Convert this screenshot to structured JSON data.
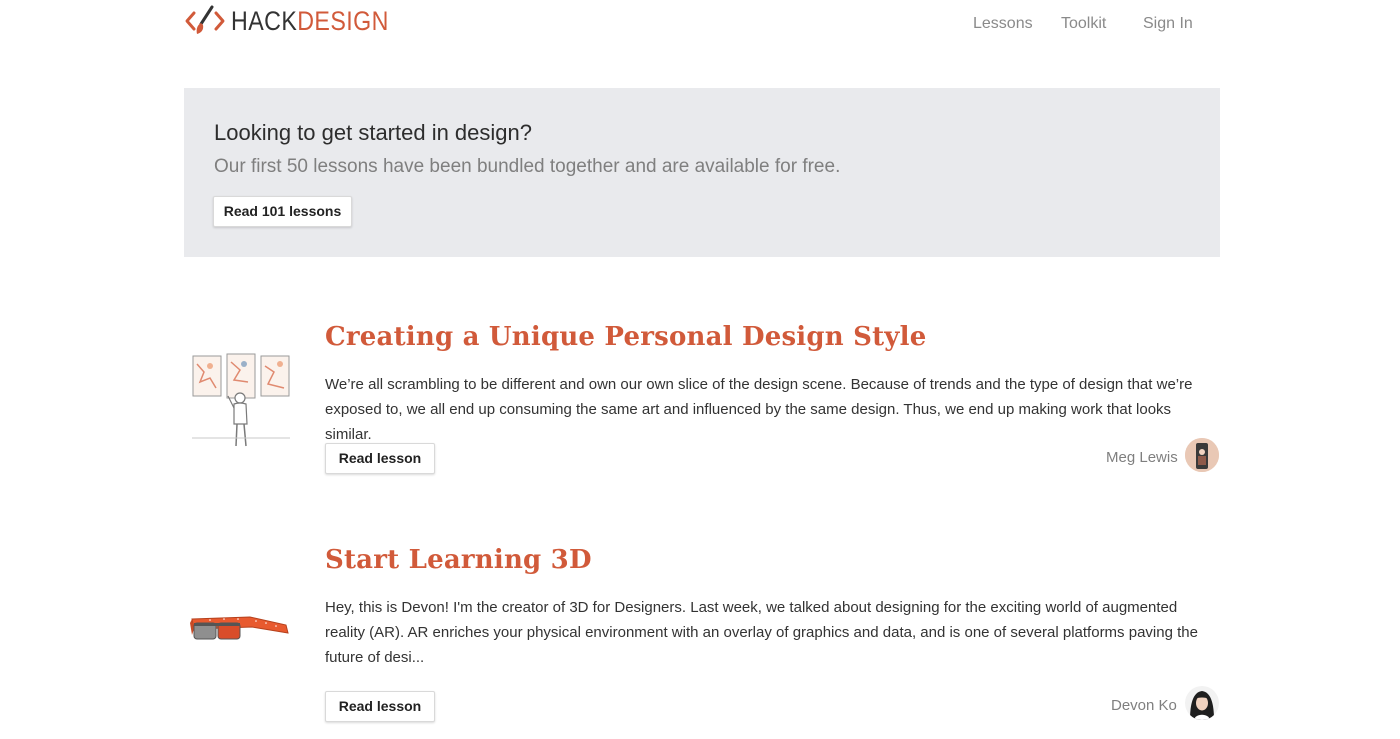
{
  "header": {
    "logo": {
      "hack": "HACK",
      "design": "DESIGN"
    },
    "nav": [
      {
        "label": "Lessons"
      },
      {
        "label": "Toolkit"
      },
      {
        "label": "Sign In"
      }
    ]
  },
  "banner": {
    "title": "Looking to get started in design?",
    "subtitle": "Our first 50 lessons have been bundled together and are available for free.",
    "button_label": "Read 101 lessons"
  },
  "lessons": [
    {
      "title": "Creating a Unique Personal Design Style",
      "body": "We’re all scrambling to be different and own our own slice of the design scene. Because of trends and the type of design that we’re exposed to, we all end up consuming the same art and influenced by the same design. Thus, we end up making work that looks similar.",
      "button_label": "Read lesson",
      "author": "Meg Lewis"
    },
    {
      "title": "Start Learning 3D",
      "body": "Hey, this is Devon! I'm the creator of 3D for Designers. Last week, we talked about designing for the exciting world of augmented reality (AR). AR enriches your physical environment with an overlay of graphics and data, and is one of several platforms paving the future of desi...",
      "button_label": "Read lesson",
      "author": "Devon Ko"
    }
  ],
  "colors": {
    "accent": "#d15a3a",
    "banner_bg": "#e9eaed",
    "nav_text": "#8a8a8a"
  },
  "icons": {
    "logo": "brush-code-brackets-icon",
    "lesson_0_thumb": "art-gallery-illustration",
    "lesson_1_thumb": "3d-glasses-illustration"
  }
}
